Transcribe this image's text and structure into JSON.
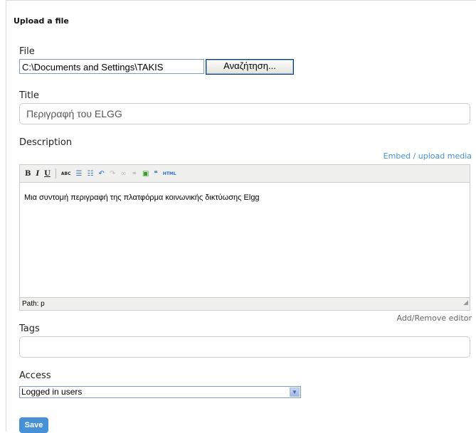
{
  "form": {
    "title": "Upload a file",
    "file_label": "File",
    "file_path": "C:\\Documents and Settings\\TAKIS",
    "browse_label": "Αναζήτηση...",
    "title_label": "Title",
    "title_value": "Περιγραφή του ELGG",
    "description_label": "Description",
    "embed_link": "Embed / upload media",
    "toolbar": [
      "bold-icon",
      "italic-icon",
      "underline-icon",
      "spellcheck-icon",
      "bullet-list-icon",
      "numbered-list-icon",
      "undo-icon",
      "redo-icon",
      "link-icon",
      "unlink-icon",
      "image-icon",
      "blockquote-icon",
      "html-icon"
    ],
    "description_value": "Μια συντομή περιγραφή της πλατφόρμα κοινωνικής δικτύωσης Elgg",
    "path_text": "Path: p",
    "add_remove_editor": "Add/Remove editor",
    "tags_label": "Tags",
    "tags_value": "",
    "access_label": "Access",
    "access_value": "Logged in users",
    "save_label": "Save"
  }
}
